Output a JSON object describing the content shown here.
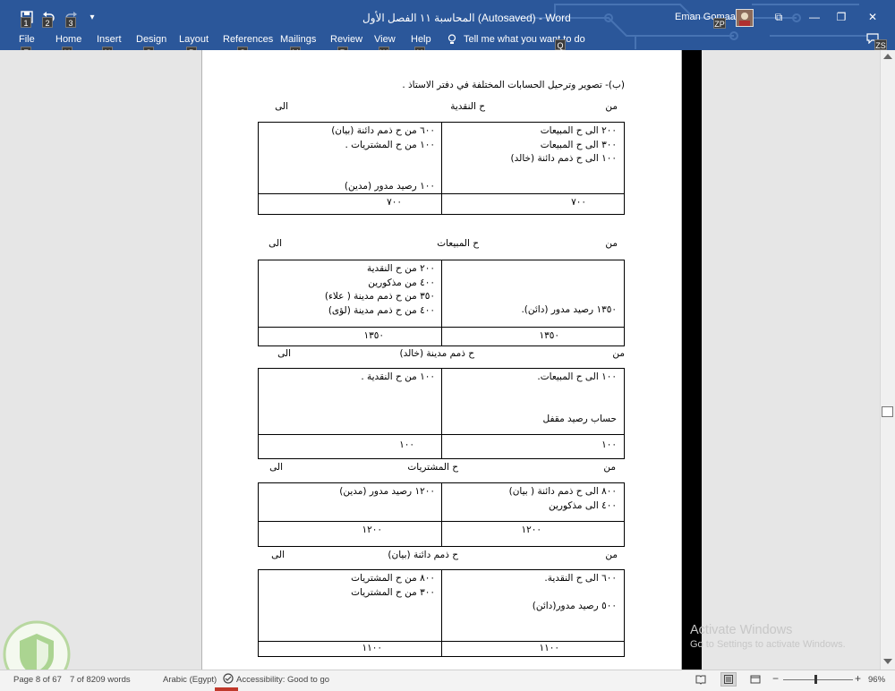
{
  "title_bar": {
    "document_title": "المحاسبة ١١ الفصل الأول (Autosaved)  -  Word",
    "user_name": "Eman Gomaa Ali",
    "user_initials_tip": "ZP",
    "quick_access": {
      "save_tip": "1",
      "undo_tip": "2",
      "redo_tip": "3",
      "customize_glyph": "▾"
    },
    "window_buttons": {
      "ribbon_options": "⧉",
      "minimize": "—",
      "maximize": "❐",
      "close": "✕"
    },
    "colors": {
      "ribbon": "#2b579a"
    }
  },
  "ribbon_tabs": [
    {
      "label": "File",
      "tip": "F"
    },
    {
      "label": "Home",
      "tip": "H"
    },
    {
      "label": "Insert",
      "tip": "N"
    },
    {
      "label": "Design",
      "tip": "G"
    },
    {
      "label": "Layout",
      "tip": "P"
    },
    {
      "label": "References",
      "tip": "S"
    },
    {
      "label": "Mailings",
      "tip": "M"
    },
    {
      "label": "Review",
      "tip": "R"
    },
    {
      "label": "View",
      "tip": "W"
    },
    {
      "label": "Help",
      "tip": "Y"
    }
  ],
  "tell_me": {
    "text": "Tell me what you want to do",
    "tip": "Q"
  },
  "comments_tip": "ZS",
  "document": {
    "intro": "(ب)- تصوير وترحيل الحسابات المختلفة في دفتر الاستاذ .",
    "ledgers": [
      {
        "from": "من",
        "account": "ح النقدية",
        "to": "الى",
        "debit": [
          "٢٠٠ الى ح المبيعات",
          "٣٠٠ الى ح المبيعات",
          "١٠٠ الى ح ذمم دائنة (خالد)"
        ],
        "credit": [
          "٦٠٠ من ح ذمم دائنة (بيان)",
          "١٠٠ من ح المشتريات .",
          "",
          "",
          "١٠٠ رصيد مدور (مدين)"
        ],
        "debit_total": "٧٠٠",
        "credit_total": "٧٠٠"
      },
      {
        "from": "من",
        "account": "ح المبيعات",
        "to": "الى",
        "debit": [
          "",
          "",
          "",
          "١٣٥٠ رصيد مدور (دائن)."
        ],
        "credit": [
          "٢٠٠ من ح النقدية",
          "٤٠٠ من مذكورين",
          "٣٥٠ من ح ذمم مدينة ( علاء)",
          "٤٠٠ من ح ذمم مدينة (لؤى)"
        ],
        "debit_total": "١٣٥٠",
        "credit_total": "١٣٥٠"
      },
      {
        "from": "من",
        "account": "ح ذمم مدينة (خالد)",
        "to": "الى",
        "debit": [
          "١٠٠ الى ح المبيعات.",
          "",
          "",
          "حساب رصيد مقفل"
        ],
        "credit": [
          "١٠٠ من ح النقدية ."
        ],
        "debit_total": "١٠٠",
        "credit_total": "١٠٠"
      },
      {
        "from": "من",
        "account": "ح المشتريات",
        "to": "الى",
        "debit": [
          "٨٠٠ الى ح ذمم دائنة ( بيان)",
          "٤٠٠ الى مذكورين"
        ],
        "credit": [
          "١٢٠٠ رصيد مدور (مدين)"
        ],
        "debit_total": "١٢٠٠",
        "credit_total": "١٢٠٠"
      },
      {
        "from": "من",
        "account": "ح ذمم دائنة (بيان)",
        "to": "الى",
        "debit": [
          "٦٠٠ الى ح النقدية.",
          "",
          "٥٠٠ رصيد مدور(دائن)"
        ],
        "credit": [
          "٨٠٠ من ح المشتريات",
          "٣٠٠ من ح المشتريات"
        ],
        "debit_total": "١١٠٠",
        "credit_total": "١١٠٠"
      }
    ]
  },
  "watermark": {
    "title": "Activate Windows",
    "subtitle": "Go to Settings to activate Windows."
  },
  "status_bar": {
    "page": "Page 8 of 67",
    "words": "7 of 8209 words",
    "language": "Arabic (Egypt)",
    "accessibility": "Accessibility: Good to go",
    "zoom_minus": "−",
    "zoom_plus": "+",
    "zoom": "96%",
    "zoom_level_percent": 96
  }
}
